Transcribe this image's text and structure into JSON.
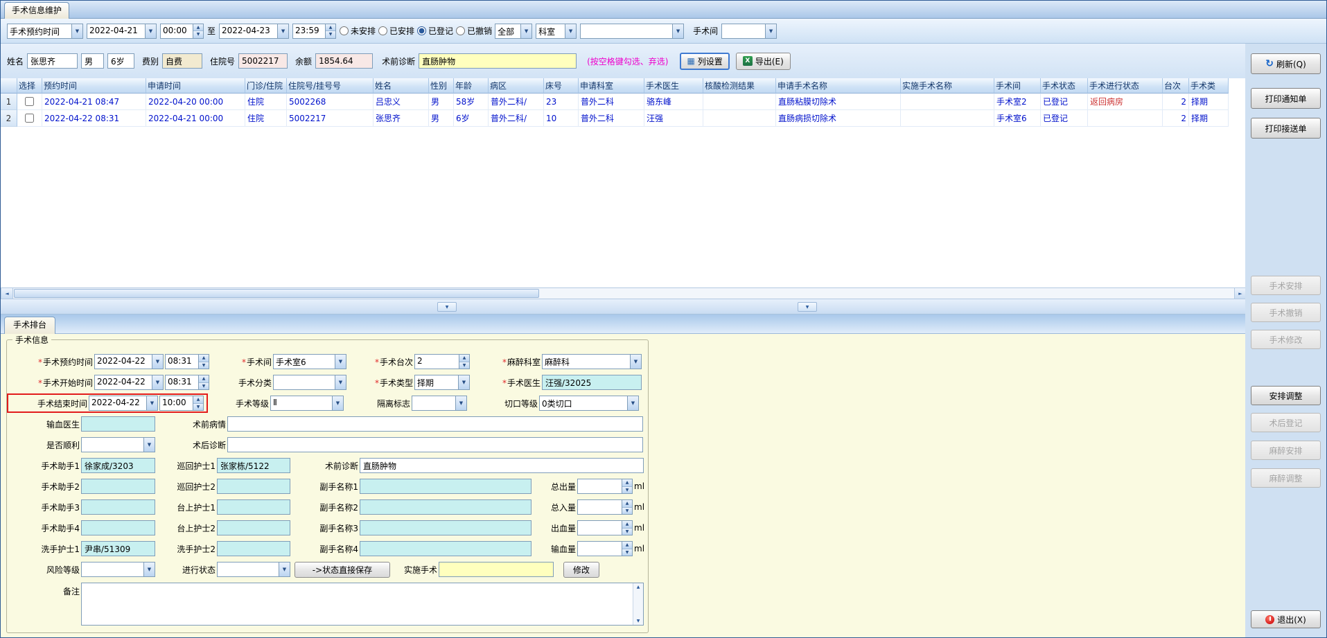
{
  "window": {
    "main_tab": "手术信息维护"
  },
  "colors": {
    "accent_blue": "#2a5a9c",
    "row_text_blue": "#0011cc",
    "alert_red": "#cc3333",
    "hint_magenta": "#ee00cc",
    "input_cyan": "#c8f0f0",
    "input_yellow": "#ffffbe",
    "panel_yellow": "#fafae1",
    "required_red": "#e02b2b"
  },
  "icons": {
    "refresh": "↻",
    "column_settings": "▦",
    "export": "X",
    "dropdown": "▼",
    "up": "▲",
    "down": "▼",
    "left": "◄",
    "right": "►"
  },
  "filter": {
    "time_field": "手术预约时间",
    "date_from": "2022-04-21",
    "time_from": "00:00",
    "to_label": "至",
    "date_to": "2022-04-23",
    "time_to": "23:59",
    "status_options": [
      {
        "label": "未安排",
        "selected": false
      },
      {
        "label": "已安排",
        "selected": false
      },
      {
        "label": "已登记",
        "selected": true
      },
      {
        "label": "已撤销",
        "selected": false
      }
    ],
    "scope_value": "全部",
    "dept_value": "科室",
    "dept2_value": "",
    "room_label": "手术间",
    "room_value": ""
  },
  "patient_bar": {
    "name_label": "姓名",
    "name": "张思齐",
    "sex": "男",
    "age": "6岁",
    "fee_label": "费别",
    "fee": "自费",
    "admission_label": "住院号",
    "admission_no": "5002217",
    "balance_label": "余额",
    "balance": "1854.64",
    "prediagnosis_label": "术前诊断",
    "prediagnosis": "直肠肿物",
    "hint": "(按空格键勾选、弃选)",
    "column_settings_btn": "列设置",
    "export_btn": "导出(E)"
  },
  "grid": {
    "headers": [
      "选择",
      "预约时间",
      "申请时间",
      "门诊/住院",
      "住院号/挂号号",
      "姓名",
      "性别",
      "年龄",
      "病区",
      "床号",
      "申请科室",
      "手术医生",
      "核酸检测结果",
      "申请手术名称",
      "实施手术名称",
      "手术间",
      "手术状态",
      "手术进行状态",
      "台次",
      "手术类"
    ],
    "rows": [
      {
        "num": "1",
        "checked": false,
        "cells": [
          "2022-04-21 08:47",
          "2022-04-20 00:00",
          "住院",
          "5002268",
          "吕忠义",
          "男",
          "58岁",
          "普外二科/",
          "23",
          "普外二科",
          "骆东峰",
          "",
          "直肠粘膜切除术",
          "",
          "手术室2",
          "已登记",
          "返回病房",
          "2",
          "择期"
        ],
        "red_cells": [
          16
        ]
      },
      {
        "num": "2",
        "checked": false,
        "cells": [
          "2022-04-22 08:31",
          "2022-04-21 00:00",
          "住院",
          "5002217",
          "张思齐",
          "男",
          "6岁",
          "普外二科/",
          "10",
          "普外二科",
          "汪强",
          "",
          "直肠病损切除术",
          "",
          "手术室6",
          "已登记",
          "",
          "2",
          "择期"
        ],
        "red_cells": []
      }
    ]
  },
  "right_panel": {
    "refresh": "刷新(Q)",
    "print_notice": "打印通知单",
    "print_escort": "打印接送单",
    "surgery_arrange": "手术安排",
    "surgery_cancel": "手术撤销",
    "surgery_modify": "手术修改",
    "arrange_adjust": "安排调整",
    "post_register": "术后登记",
    "anesthesia_arrange": "麻醉安排",
    "anesthesia_adjust": "麻醉调整",
    "exit": "退出(X)"
  },
  "form": {
    "tab_label": "手术排台",
    "group_title": "手术信息",
    "required_mark": "*",
    "appointment": {
      "label": "手术预约时间",
      "date": "2022-04-22",
      "time": "08:31"
    },
    "room": {
      "label": "手术间",
      "value": "手术室6"
    },
    "table_no": {
      "label": "手术台次",
      "value": "2"
    },
    "anesthesia_dept": {
      "label": "麻醉科室",
      "value": "麻醉科"
    },
    "start": {
      "label": "手术开始时间",
      "date": "2022-04-22",
      "time": "08:31"
    },
    "category": {
      "label": "手术分类",
      "value": ""
    },
    "type": {
      "label": "手术类型",
      "value": "择期"
    },
    "surgeon": {
      "label": "手术医生",
      "value": "汪强/32025"
    },
    "end": {
      "label": "手术结束时间",
      "date": "2022-04-22",
      "time": "10:00"
    },
    "grade": {
      "label": "手术等级",
      "value": "Ⅱ"
    },
    "isolation": {
      "label": "隔离标志",
      "value": ""
    },
    "incision": {
      "label": "切口等级",
      "value": "0类切口"
    },
    "transfusion_doctor": {
      "label": "输血医生",
      "value": ""
    },
    "pre_condition": {
      "label": "术前病情",
      "value": ""
    },
    "smooth": {
      "label": "是否顺利",
      "value": ""
    },
    "post_diagnosis": {
      "label": "术后诊断",
      "value": ""
    },
    "assistant1": {
      "label": "手术助手1",
      "value": "徐家成/3203"
    },
    "assistant2": {
      "label": "手术助手2",
      "value": ""
    },
    "assistant3": {
      "label": "手术助手3",
      "value": ""
    },
    "assistant4": {
      "label": "手术助手4",
      "value": ""
    },
    "circulating_nurse1": {
      "label": "巡回护士1",
      "value": "张家栋/5122"
    },
    "circulating_nurse2": {
      "label": "巡回护士2",
      "value": ""
    },
    "table_nurse1": {
      "label": "台上护士1",
      "value": ""
    },
    "table_nurse2": {
      "label": "台上护士2",
      "value": ""
    },
    "washing_nurse1": {
      "label": "洗手护士1",
      "value": "尹串/51309"
    },
    "washing_nurse2": {
      "label": "洗手护士2",
      "value": ""
    },
    "pre_diagnosis": {
      "label": "术前诊断",
      "value": "直肠肿物"
    },
    "sub_name1": {
      "label": "副手名称1",
      "value": ""
    },
    "sub_name2": {
      "label": "副手名称2",
      "value": ""
    },
    "sub_name3": {
      "label": "副手名称3",
      "value": ""
    },
    "sub_name4": {
      "label": "副手名称4",
      "value": ""
    },
    "total_out": {
      "label": "总出量",
      "value": "",
      "unit": "ml"
    },
    "total_in": {
      "label": "总入量",
      "value": "",
      "unit": "ml"
    },
    "bleeding": {
      "label": "出血量",
      "value": "",
      "unit": "ml"
    },
    "transfusion_vol": {
      "label": "输血量",
      "value": "",
      "unit": "ml"
    },
    "risk": {
      "label": "风险等级",
      "value": ""
    },
    "progress": {
      "label": "进行状态",
      "value": ""
    },
    "save_state_btn": "->状态直接保存",
    "implemented": {
      "label": "实施手术",
      "value": ""
    },
    "modify_btn": "修改",
    "remark": {
      "label": "备注",
      "value": ""
    }
  }
}
